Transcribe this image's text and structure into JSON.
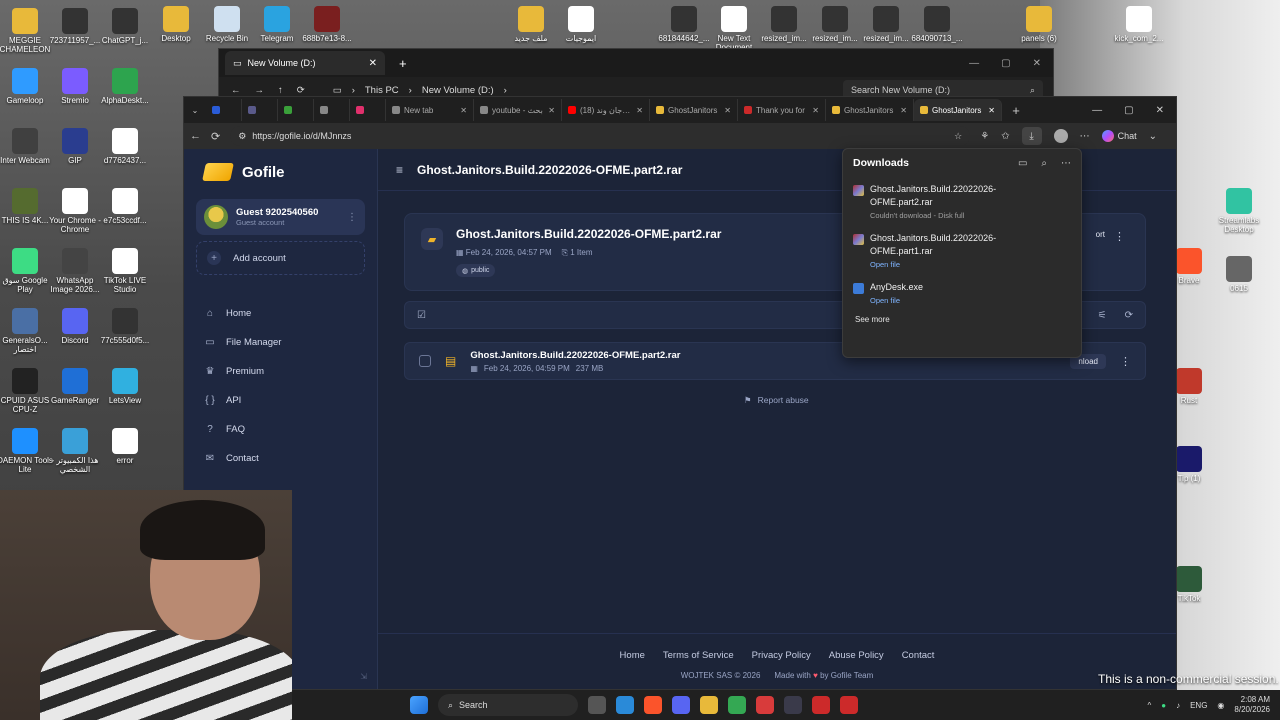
{
  "desktop": {
    "icons_left": [
      {
        "label": "MEGGIE CHAMELEON",
        "color": "#e8b93a"
      },
      {
        "label": "Gameloop",
        "color": "#2f9bff"
      },
      {
        "label": "Inter Webcam",
        "color": "#404040"
      },
      {
        "label": "THIS IS 4K...",
        "color": "#556b2f"
      },
      {
        "label": "سوق Google Play",
        "color": "#3ddc84"
      },
      {
        "label": "GeneralsO... اختصار",
        "color": "#4a6fa5"
      },
      {
        "label": "CPUID ASUS CPU-Z",
        "color": "#222222"
      },
      {
        "label": "DAEMON Tools Lite",
        "color": "#1e90ff"
      }
    ],
    "icons_col2": [
      {
        "label": "723711957_...",
        "color": "#333333"
      },
      {
        "label": "Stremio",
        "color": "#7b5cff"
      },
      {
        "label": "GIP",
        "color": "#2a3d8f"
      },
      {
        "label": "Your Chrome - Chrome",
        "color": "#ffffff"
      },
      {
        "label": "WhatsApp Image 2026...",
        "color": "#444444"
      },
      {
        "label": "Discord",
        "color": "#5865f2"
      },
      {
        "label": "GameRanger",
        "color": "#1f6fd6"
      },
      {
        "label": "هذا الكمبيوتر - الشخصي",
        "color": "#3aa0d8"
      }
    ],
    "icons_col3": [
      {
        "label": "ChatGPT_j...",
        "color": "#333333"
      },
      {
        "label": "AlphaDeskt...",
        "color": "#2da44e"
      },
      {
        "label": "d7762437...",
        "color": "#ffffff"
      },
      {
        "label": "e7c53ccdf...",
        "color": "#ffffff"
      },
      {
        "label": "TikTok LIVE Studio",
        "color": "#ffffff"
      },
      {
        "label": "77c555d0f5...",
        "color": "#333333"
      },
      {
        "label": "LetsView",
        "color": "#30b0e0"
      },
      {
        "label": "error",
        "color": "#ffffff"
      }
    ],
    "icons_top": [
      {
        "label": "Desktop",
        "color": "#e8b93a"
      },
      {
        "label": "Recycle Bin",
        "color": "#cfe0f0"
      },
      {
        "label": "Telegram",
        "color": "#2aa3e0"
      },
      {
        "label": "688b7e13-8...",
        "color": "#7a1f1f"
      },
      {
        "label": "ملف جديد",
        "color": "#e8b93a"
      },
      {
        "label": "ايموجيات",
        "color": "#ffffff"
      },
      {
        "label": "681844642_...",
        "color": "#333333"
      },
      {
        "label": "New Text Document",
        "color": "#ffffff"
      },
      {
        "label": "resized_im...",
        "color": "#333333"
      },
      {
        "label": "resized_im...",
        "color": "#333333"
      },
      {
        "label": "resized_im...",
        "color": "#333333"
      },
      {
        "label": "684090713_...",
        "color": "#333333"
      },
      {
        "label": "panels (6)",
        "color": "#e8b93a"
      },
      {
        "label": "kick_com_2...",
        "color": "#ffffff"
      }
    ],
    "icons_right": [
      {
        "label": "Streamlabs Desktop",
        "color": "#31c3a2"
      },
      {
        "label": "Brave",
        "color": "#fb542b"
      },
      {
        "label": "0615",
        "color": "#666666"
      },
      {
        "label": "Rust",
        "color": "#c0392b"
      },
      {
        "label": "Tip (1)",
        "color": "#1a1a6a"
      },
      {
        "label": "TikTok",
        "color": "#2d5a3a"
      }
    ]
  },
  "explorer": {
    "tab_title": "New Volume (D:)",
    "breadcrumb": [
      "This PC",
      "New Volume (D:)"
    ],
    "search_placeholder": "Search New Volume (D:)"
  },
  "browser": {
    "tabs": [
      {
        "title": "",
        "color": "#2a5cd8"
      },
      {
        "title": "",
        "color": "#5a5a8a"
      },
      {
        "title": "",
        "color": "#3aa03a"
      },
      {
        "title": "",
        "color": "#888888"
      },
      {
        "title": "",
        "color": "#e1306c"
      },
      {
        "title": "New tab",
        "color": "#888888"
      },
      {
        "title": "youtube - بحث",
        "color": "#888888"
      },
      {
        "title": "(18) مهرجان وند",
        "color": "#ff0000"
      },
      {
        "title": "GhostJanitors",
        "color": "#e8b93a"
      },
      {
        "title": "Thank you for",
        "color": "#cc2a2a"
      },
      {
        "title": "GhostJanitors",
        "color": "#e8b93a"
      },
      {
        "title": "GhostJanitors",
        "color": "#e8b93a"
      }
    ],
    "url": "https://gofile.io/d/MJnnzs",
    "chat_label": "Chat"
  },
  "gofile": {
    "brand": "Gofile",
    "account": {
      "name": "Guest 9202540560",
      "sub": "Guest account"
    },
    "add_account": "Add account",
    "menu": [
      {
        "label": "Home",
        "icon": "home-icon",
        "glyph": "⌂"
      },
      {
        "label": "File Manager",
        "icon": "folder-icon",
        "glyph": "▭"
      },
      {
        "label": "Premium",
        "icon": "crown-icon",
        "glyph": "♛"
      },
      {
        "label": "API",
        "icon": "braces-icon",
        "glyph": "{ }"
      },
      {
        "label": "FAQ",
        "icon": "question-icon",
        "glyph": "?"
      },
      {
        "label": "Contact",
        "icon": "mail-icon",
        "glyph": "✉"
      }
    ],
    "page_title": "Ghost.Janitors.Build.22022026-OFME.part2.rar",
    "folder": {
      "name": "Ghost.Janitors.Build.22022026-OFME.part2.rar",
      "date": "Feb 24, 2026, 04:57 PM",
      "items": "1 Item",
      "badge": "public",
      "action_label": "ort"
    },
    "file": {
      "name": "Ghost.Janitors.Build.22022026-OFME.part2.rar",
      "date": "Feb 24, 2026, 04:59 PM",
      "size": "237 MB",
      "download_label": "nload"
    },
    "report_abuse": "Report abuse",
    "footer_links": [
      "Home",
      "Terms of Service",
      "Privacy Policy",
      "Abuse Policy",
      "Contact"
    ],
    "copyright": "WOJTEK SAS © 2026",
    "made_with_pre": "Made with",
    "made_with_post": "by Gofile Team"
  },
  "downloads": {
    "title": "Downloads",
    "items": [
      {
        "name": "Ghost.Janitors.Build.22022026-OFME.part2.rar",
        "status": "Couldn't download - Disk full",
        "type": "rar",
        "link": false
      },
      {
        "name": "Ghost.Janitors.Build.22022026-OFME.part1.rar",
        "status": "Open file",
        "type": "rar",
        "link": true
      },
      {
        "name": "AnyDesk.exe",
        "status": "Open file",
        "type": "exe",
        "link": true
      }
    ],
    "see_more": "See more"
  },
  "taskbar": {
    "search_label": "Search",
    "apps": [
      {
        "name": "edge",
        "color": "#2a8ad8"
      },
      {
        "name": "brave",
        "color": "#fb542b"
      },
      {
        "name": "discord",
        "color": "#5865f2"
      },
      {
        "name": "file-explorer",
        "color": "#e8b93a"
      },
      {
        "name": "chrome",
        "color": "#34a853"
      },
      {
        "name": "app-red",
        "color": "#d83b3b"
      },
      {
        "name": "steam",
        "color": "#3a3a4a"
      },
      {
        "name": "app-red-2",
        "color": "#cc2a2a"
      },
      {
        "name": "app-red-3",
        "color": "#cc2a2a"
      }
    ],
    "lang": "ENG",
    "time": "2:08 AM",
    "date": "8/20/2026"
  },
  "overlay_text": "This is a non-commercial session."
}
